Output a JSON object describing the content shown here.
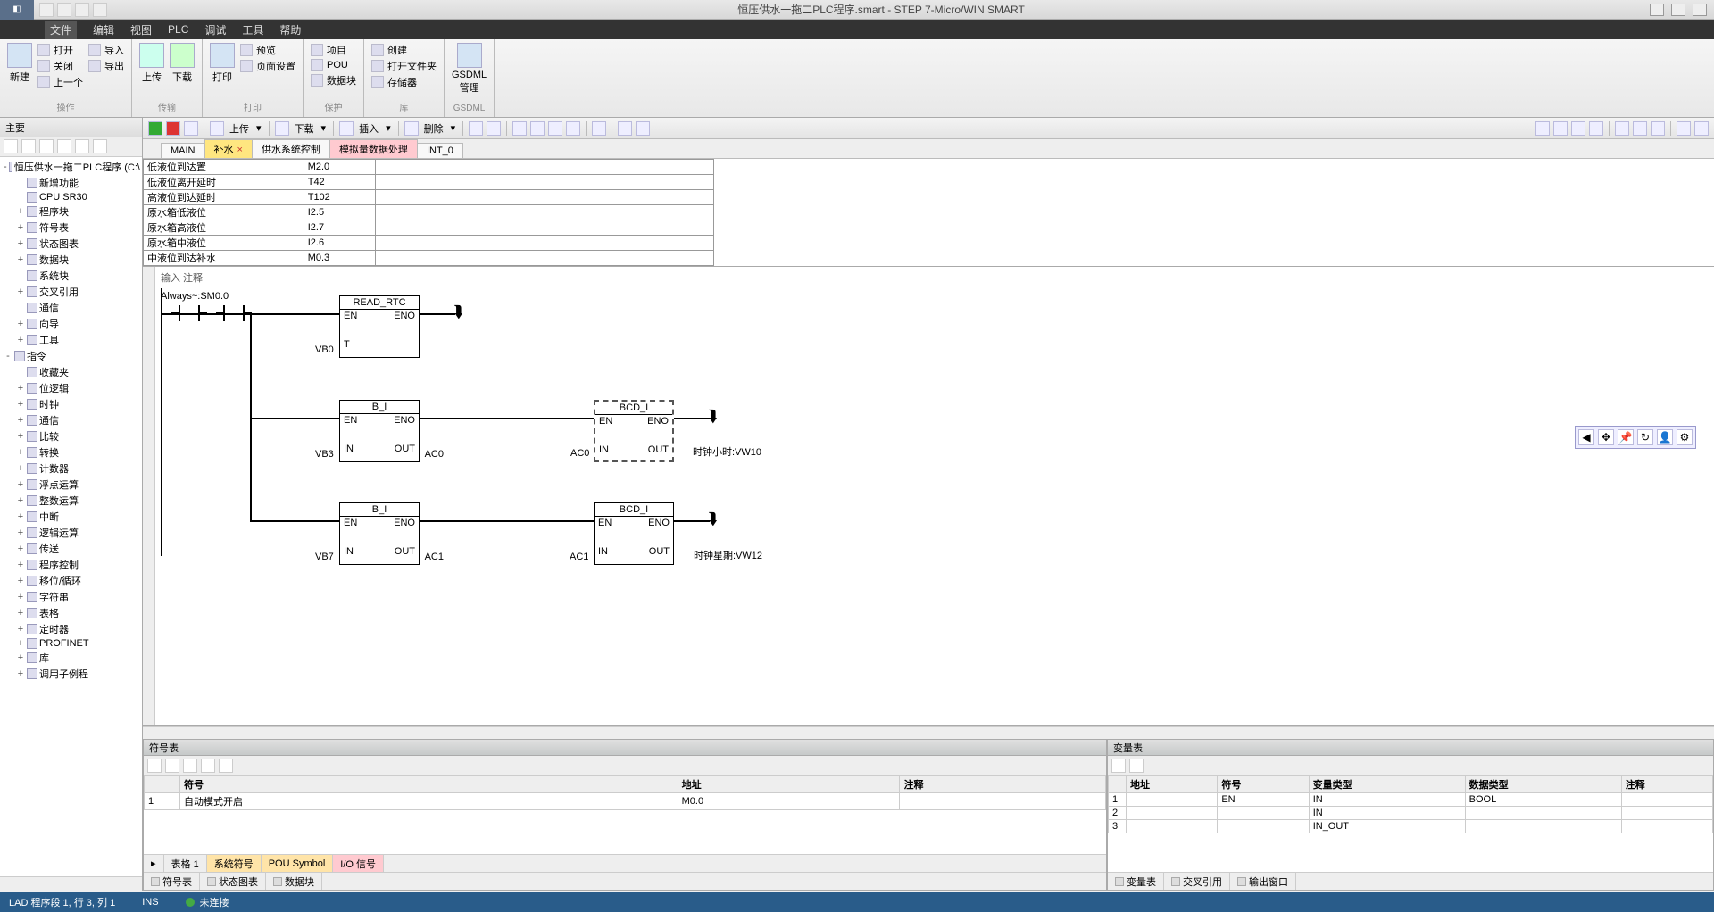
{
  "title": "恒压供水一拖二PLC程序.smart - STEP 7-Micro/WIN SMART",
  "menu": [
    "文件",
    "编辑",
    "视图",
    "PLC",
    "调试",
    "工具",
    "帮助"
  ],
  "ribbon": {
    "group1": {
      "new": "新建",
      "open": "打开",
      "close": "关闭",
      "import": "导入",
      "export": "导出",
      "prev": "上一个"
    },
    "group2": {
      "upload": "上传",
      "download": "下载"
    },
    "group3": {
      "print": "打印",
      "preview": "预览",
      "page": "页面设置"
    },
    "group4": {
      "proj": "项目",
      "pou": "POU",
      "dblock": "数据块"
    },
    "group5": {
      "create": "创建",
      "openlib": "打开文件夹",
      "memory": "存储器"
    },
    "group6": {
      "gsdml": "GSDML\n管理"
    }
  },
  "toolbar": {
    "upload": "上传",
    "download": "下载",
    "insert": "插入",
    "delete": "删除"
  },
  "tabs": [
    {
      "label": "MAIN",
      "kind": ""
    },
    {
      "label": "补水",
      "kind": "active"
    },
    {
      "label": "供水系统控制",
      "kind": ""
    },
    {
      "label": "模拟量数据处理",
      "kind": "special"
    },
    {
      "label": "INT_0",
      "kind": ""
    }
  ],
  "var_table": [
    {
      "n": "低液位到达置",
      "a": "M2.0"
    },
    {
      "n": "低液位离开延时",
      "a": "T42"
    },
    {
      "n": "高液位到达延时",
      "a": "T102"
    },
    {
      "n": "原水箱低液位",
      "a": "I2.5"
    },
    {
      "n": "原水箱高液位",
      "a": "I2.7"
    },
    {
      "n": "原水箱中液位",
      "a": "I2.6"
    },
    {
      "n": "中液位到达补水",
      "a": "M0.3"
    }
  ],
  "network_title": "输入 注释",
  "contact_label": "Always~:SM0.0",
  "fb1": {
    "title": "READ_RTC",
    "en": "EN",
    "eno": "ENO",
    "p1": "VB0",
    "p1l": "T"
  },
  "fb2": {
    "title": "B_I",
    "en": "EN",
    "eno": "ENO",
    "in": "VB3",
    "inl": "IN",
    "out": "AC0",
    "outl": "OUT"
  },
  "fb3": {
    "title": "BCD_I",
    "en": "EN",
    "eno": "ENO",
    "in": "AC0",
    "inl": "IN",
    "out": "时钟小时:VW10",
    "outl": "OUT"
  },
  "fb4": {
    "title": "B_I",
    "en": "EN",
    "eno": "ENO",
    "in": "VB7",
    "inl": "IN",
    "out": "AC1",
    "outl": "OUT"
  },
  "fb5": {
    "title": "BCD_I",
    "en": "EN",
    "eno": "ENO",
    "in": "AC1",
    "inl": "IN",
    "out": "时钟星期:VW12",
    "outl": "OUT"
  },
  "tree": [
    {
      "l": "恒压供水一拖二PLC程序 (C:\\",
      "d": 0,
      "e": "-"
    },
    {
      "l": "新增功能",
      "d": 1,
      "e": ""
    },
    {
      "l": "CPU SR30",
      "d": 1,
      "e": ""
    },
    {
      "l": "程序块",
      "d": 1,
      "e": "+"
    },
    {
      "l": "符号表",
      "d": 1,
      "e": "+"
    },
    {
      "l": "状态图表",
      "d": 1,
      "e": "+"
    },
    {
      "l": "数据块",
      "d": 1,
      "e": "+"
    },
    {
      "l": "系统块",
      "d": 1,
      "e": ""
    },
    {
      "l": "交叉引用",
      "d": 1,
      "e": "+"
    },
    {
      "l": "通信",
      "d": 1,
      "e": ""
    },
    {
      "l": "向导",
      "d": 1,
      "e": "+"
    },
    {
      "l": "工具",
      "d": 1,
      "e": "+"
    },
    {
      "l": "指令",
      "d": 0,
      "e": "-"
    },
    {
      "l": "收藏夹",
      "d": 1,
      "e": ""
    },
    {
      "l": "位逻辑",
      "d": 1,
      "e": "+"
    },
    {
      "l": "时钟",
      "d": 1,
      "e": "+"
    },
    {
      "l": "通信",
      "d": 1,
      "e": "+"
    },
    {
      "l": "比较",
      "d": 1,
      "e": "+"
    },
    {
      "l": "转换",
      "d": 1,
      "e": "+"
    },
    {
      "l": "计数器",
      "d": 1,
      "e": "+"
    },
    {
      "l": "浮点运算",
      "d": 1,
      "e": "+"
    },
    {
      "l": "整数运算",
      "d": 1,
      "e": "+"
    },
    {
      "l": "中断",
      "d": 1,
      "e": "+"
    },
    {
      "l": "逻辑运算",
      "d": 1,
      "e": "+"
    },
    {
      "l": "传送",
      "d": 1,
      "e": "+"
    },
    {
      "l": "程序控制",
      "d": 1,
      "e": "+"
    },
    {
      "l": "移位/循环",
      "d": 1,
      "e": "+"
    },
    {
      "l": "字符串",
      "d": 1,
      "e": "+"
    },
    {
      "l": "表格",
      "d": 1,
      "e": "+"
    },
    {
      "l": "定时器",
      "d": 1,
      "e": "+"
    },
    {
      "l": "PROFINET",
      "d": 1,
      "e": "+"
    },
    {
      "l": "库",
      "d": 1,
      "e": "+"
    },
    {
      "l": "调用子例程",
      "d": 1,
      "e": "+"
    }
  ],
  "sym_panel": {
    "title": "符号表",
    "headers": [
      "",
      "",
      "符号",
      "地址",
      "注释"
    ],
    "row": {
      "idx": "1",
      "sym": "自动模式开启",
      "addr": "M0.0",
      "comment": ""
    },
    "tabs": [
      "表格 1",
      "系统符号",
      "POU Symbol",
      "I/O 信号"
    ],
    "btabs": [
      "符号表",
      "状态图表",
      "数据块"
    ]
  },
  "vt_panel": {
    "title": "变量表",
    "headers": [
      "",
      "地址",
      "符号",
      "变量类型",
      "数据类型",
      "注释"
    ],
    "rows": [
      {
        "i": "1",
        "sym": "EN",
        "vt": "IN",
        "dt": "BOOL"
      },
      {
        "i": "2",
        "sym": "",
        "vt": "IN",
        "dt": ""
      },
      {
        "i": "3",
        "sym": "",
        "vt": "IN_OUT",
        "dt": ""
      }
    ],
    "btabs": [
      "变量表",
      "交叉引用",
      "输出窗口"
    ]
  },
  "status": {
    "left": "LAD 程序段 1, 行 3, 列 1",
    "ins": "INS",
    "conn": "未连接"
  }
}
